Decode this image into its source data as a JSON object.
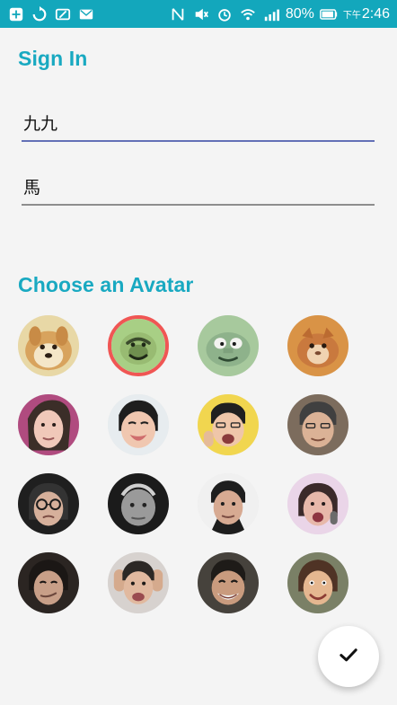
{
  "status_bar": {
    "battery": "80%",
    "time": "2:46",
    "time_prefix": "下午"
  },
  "sign_in": {
    "title": "Sign In",
    "first_field_value": "九九",
    "second_field_value": "馬"
  },
  "avatar_section": {
    "title": "Choose an Avatar",
    "avatars": [
      {
        "name": "doge",
        "selected": false
      },
      {
        "name": "cartoon-smile",
        "selected": true
      },
      {
        "name": "cartoon-face",
        "selected": false
      },
      {
        "name": "cat",
        "selected": false
      },
      {
        "name": "woman-face",
        "selected": false
      },
      {
        "name": "laughing-man",
        "selected": false
      },
      {
        "name": "man-pointing",
        "selected": false
      },
      {
        "name": "older-man",
        "selected": false
      },
      {
        "name": "woman-glasses",
        "selected": false
      },
      {
        "name": "old-man",
        "selected": false
      },
      {
        "name": "man-suit",
        "selected": false
      },
      {
        "name": "woman-shouting",
        "selected": false
      },
      {
        "name": "man-smirk",
        "selected": false
      },
      {
        "name": "man-hands-on-head",
        "selected": false
      },
      {
        "name": "man-laughing",
        "selected": false
      },
      {
        "name": "man-face",
        "selected": false
      }
    ]
  },
  "fab": {
    "icon": "check-icon"
  },
  "colors": {
    "status_bar": "#13a7bc",
    "accent": "#19a9c1",
    "active_underline": "#6370b6",
    "selected_ring": "#f05654",
    "background": "#f4f4f4"
  }
}
